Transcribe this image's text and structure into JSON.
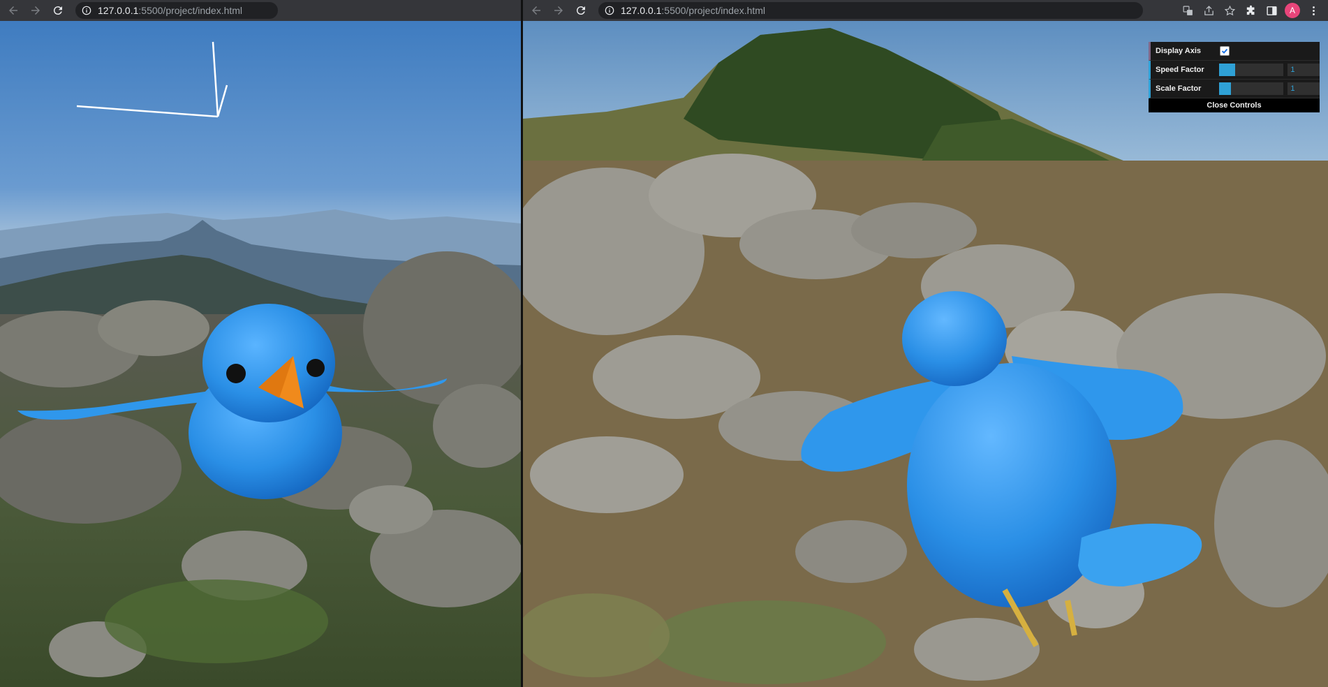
{
  "left_window": {
    "url": {
      "host": "127.0.0.1",
      "path": ":5500/project/index.html"
    }
  },
  "right_window": {
    "url": {
      "host": "127.0.0.1",
      "path": ":5500/project/index.html"
    },
    "profile_initial": "A"
  },
  "icons": {
    "back": "arrow-left-icon",
    "forward": "arrow-right-icon",
    "reload": "reload-icon",
    "info": "info-icon",
    "translate": "translate-icon",
    "share": "share-icon",
    "bookmark": "star-icon",
    "extensions": "puzzle-icon",
    "sidepanel": "side-panel-icon",
    "menu": "kebab-menu-icon"
  },
  "controls": {
    "display_axis": {
      "label": "Display Axis",
      "checked": true
    },
    "speed_factor": {
      "label": "Speed Factor",
      "value": "1",
      "fill": 0.25
    },
    "scale_factor": {
      "label": "Scale Factor",
      "value": "1",
      "fill": 0.18
    },
    "close_label": "Close Controls"
  },
  "colors": {
    "chrome_bg": "#35363a",
    "omnibox_bg": "#202124",
    "gui_accent": "#2fa1d6",
    "bird_blue": "#2a8fe6",
    "beak_orange": "#f08a1c"
  }
}
